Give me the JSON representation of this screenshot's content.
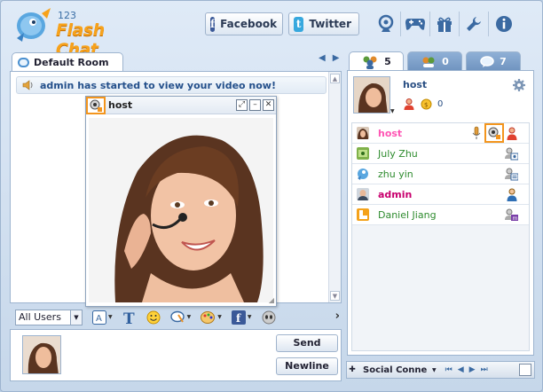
{
  "app": {
    "logo_number": "123",
    "logo_text": "Flash Chat"
  },
  "header": {
    "facebook_label": "Facebook",
    "twitter_label": "Twitter",
    "icons": [
      "webcam-icon",
      "games-icon",
      "gift-icon",
      "tools-icon",
      "info-icon"
    ]
  },
  "room": {
    "tab_label": "Default Room",
    "notice": "admin has started to view your video now!"
  },
  "video": {
    "title": "host"
  },
  "toolbar": {
    "users_select": "All Users"
  },
  "input": {
    "send_label": "Send",
    "newline_label": "Newline"
  },
  "right_tabs": [
    {
      "icon": "users-icon",
      "count": "5",
      "active": true
    },
    {
      "icon": "rooms-icon",
      "count": "0",
      "active": false
    },
    {
      "icon": "chat-icon",
      "count": "7",
      "active": false
    }
  ],
  "me": {
    "name": "host",
    "coins": "0"
  },
  "users": [
    {
      "name": "host",
      "color": "#ff55b4",
      "bold": true
    },
    {
      "name": "July Zhu",
      "color": "#2e8b2e",
      "bold": false
    },
    {
      "name": "zhu yin",
      "color": "#2e8b2e",
      "bold": false
    },
    {
      "name": "admin",
      "color": "#c8006e",
      "bold": true
    },
    {
      "name": "Daniel Jiang",
      "color": "#2e8b2e",
      "bold": false
    }
  ],
  "social_bar": {
    "label": "Social Conne"
  },
  "colors": {
    "accent": "#f3951d",
    "link_blue": "#24508b"
  }
}
